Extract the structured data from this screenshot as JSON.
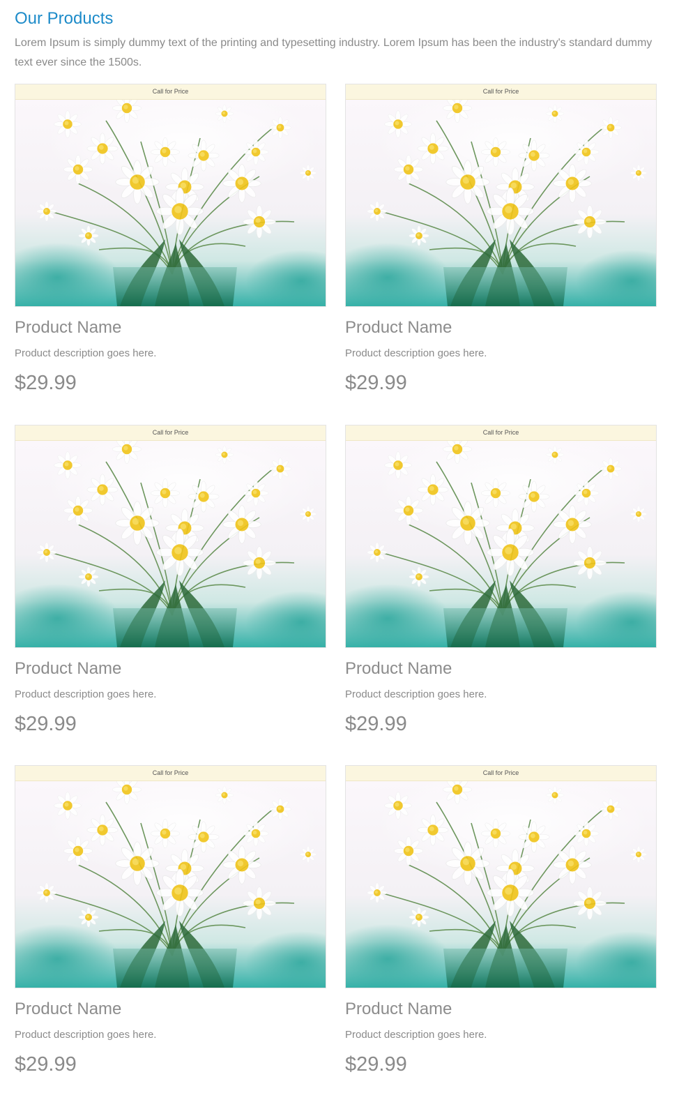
{
  "section": {
    "title": "Our Products",
    "intro": "Lorem Ipsum is simply dummy text of the printing and typesetting industry. Lorem Ipsum has been the industry's standard dummy text ever since the 1500s."
  },
  "products": [
    {
      "badge": "Call for Price",
      "name": "Product Name",
      "description": "Product description goes here.",
      "price": "$29.99",
      "image": "daisy-bouquet-photo"
    },
    {
      "badge": "Call for Price",
      "name": "Product Name",
      "description": "Product description goes here.",
      "price": "$29.99",
      "image": "daisy-bouquet-photo"
    },
    {
      "badge": "Call for Price",
      "name": "Product Name",
      "description": "Product description goes here.",
      "price": "$29.99",
      "image": "daisy-bouquet-photo"
    },
    {
      "badge": "Call for Price",
      "name": "Product Name",
      "description": "Product description goes here.",
      "price": "$29.99",
      "image": "daisy-bouquet-photo"
    },
    {
      "badge": "Call for Price",
      "name": "Product Name",
      "description": "Product description goes here.",
      "price": "$29.99",
      "image": "daisy-bouquet-photo"
    },
    {
      "badge": "Call for Price",
      "name": "Product Name",
      "description": "Product description goes here.",
      "price": "$29.99",
      "image": "daisy-bouquet-photo"
    }
  ],
  "colors": {
    "heading": "#1d8bc9",
    "text": "#8a8a8a",
    "badge_bg": "#fbf6df"
  }
}
